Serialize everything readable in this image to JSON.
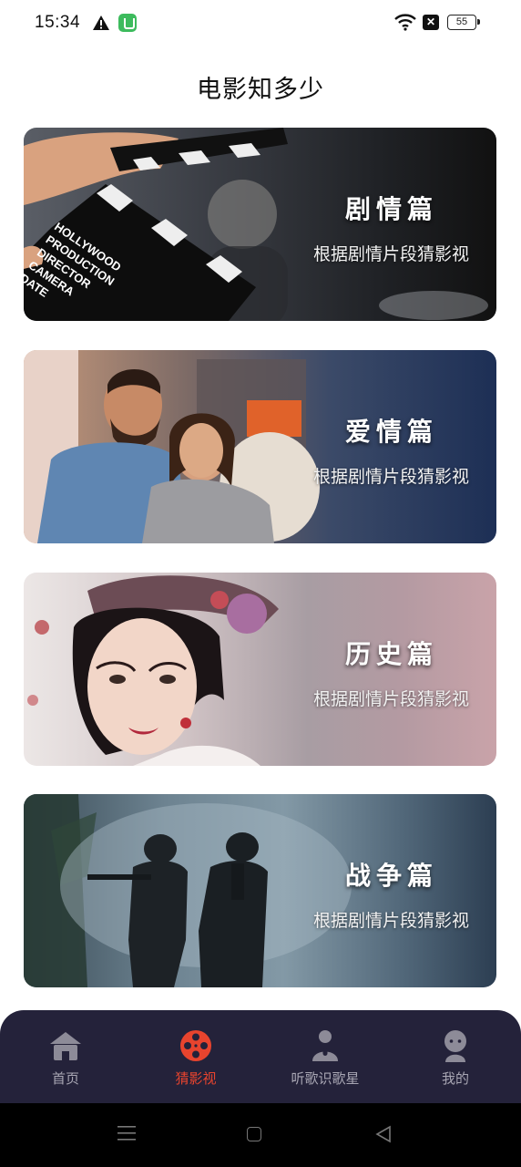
{
  "status": {
    "time": "15:34",
    "battery": "55",
    "icons": [
      "warning-icon",
      "app-notification-icon",
      "wifi-icon",
      "x-icon",
      "battery-icon"
    ]
  },
  "page": {
    "title": "电影知多少"
  },
  "cards": [
    {
      "title": "剧情篇",
      "subtitle": "根据剧情片段猜影视",
      "clapper_lines": [
        "HOLLYWOOD",
        "PRODUCTION",
        "DIRECTOR",
        "CAMERA",
        "DATE"
      ]
    },
    {
      "title": "爱情篇",
      "subtitle": "根据剧情片段猜影视"
    },
    {
      "title": "历史篇",
      "subtitle": "根据剧情片段猜影视"
    },
    {
      "title": "战争篇",
      "subtitle": "根据剧情片段猜影视"
    }
  ],
  "tabs": [
    {
      "label": "首页",
      "icon": "home-icon",
      "active": false
    },
    {
      "label": "猜影视",
      "icon": "film-reel-icon",
      "active": true
    },
    {
      "label": "听歌识歌星",
      "icon": "singer-mic-icon",
      "active": false
    },
    {
      "label": "我的",
      "icon": "profile-icon",
      "active": false
    }
  ],
  "colors": {
    "accent": "#e8442e",
    "tabbar_bg": "#24223a",
    "tab_inactive": "#a8a6b3"
  }
}
